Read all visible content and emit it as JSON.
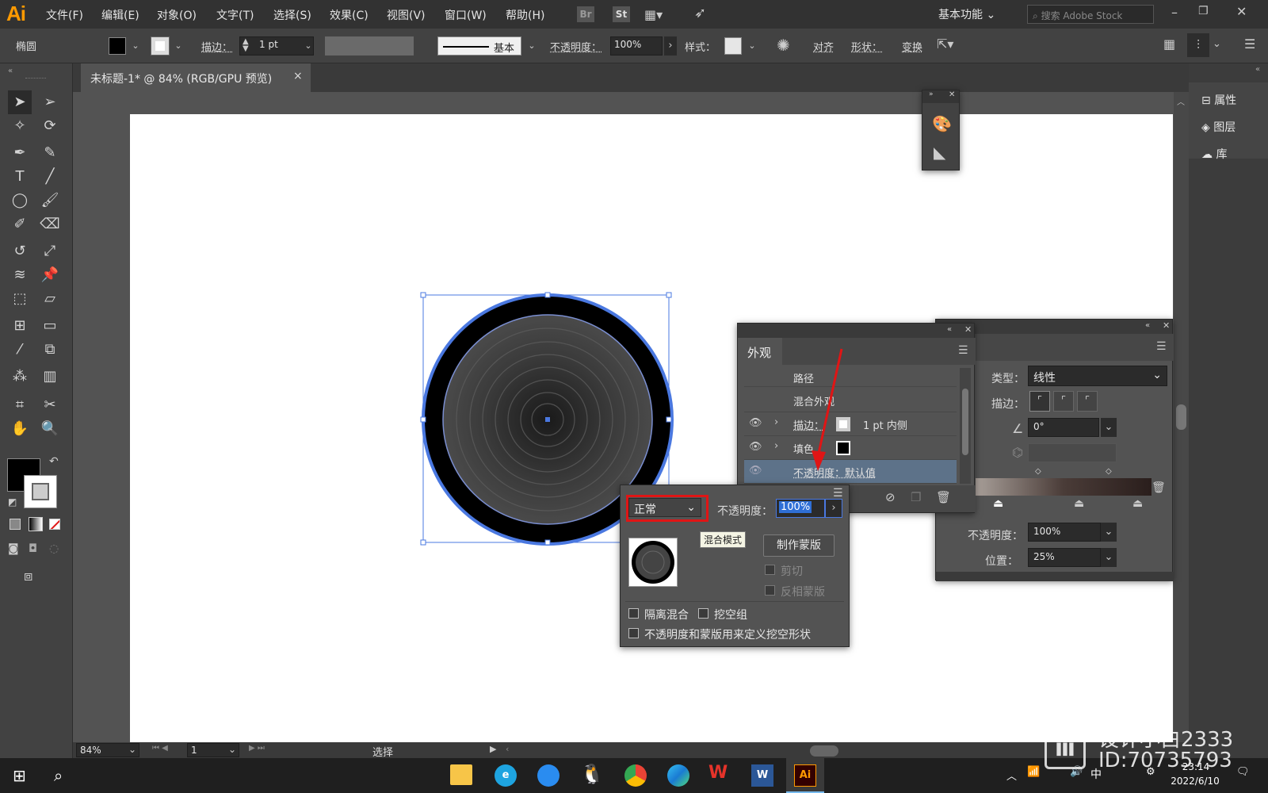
{
  "app": {
    "logo": "Ai"
  },
  "menu": [
    "文件(F)",
    "编辑(E)",
    "对象(O)",
    "文字(T)",
    "选择(S)",
    "效果(C)",
    "视图(V)",
    "窗口(W)",
    "帮助(H)"
  ],
  "menubar_right": {
    "br": "Br",
    "st": "St",
    "workspace": "基本功能",
    "search_placeholder": "搜索 Adobe Stock"
  },
  "control": {
    "object_type": "椭圆",
    "stroke_label": "描边",
    "stroke_weight": "1 pt",
    "brush_label": "基本",
    "opacity_label": "不透明度",
    "opacity_value": "100%",
    "style_label": "样式",
    "align": "对齐",
    "shape": "形状",
    "transform": "变换",
    "colon": "："
  },
  "document_tab": {
    "title": "未标题-1* @ 84% (RGB/GPU 预览)",
    "close": "×"
  },
  "right_dock": {
    "properties": "属性",
    "layers": "图层",
    "libraries": "库"
  },
  "appearance_panel": {
    "title": "外观",
    "rows": {
      "path": "路径",
      "mixed": "混合外观",
      "stroke_label": "描边",
      "stroke_detail": "1 pt  内侧",
      "fill_label": "填色",
      "opacity_row": "不透明度：默认值"
    }
  },
  "gradient_panel": {
    "type_label": "类型",
    "type_value": "线性",
    "stroke_label": "描边",
    "angle_value": "0°",
    "opacity_label": "不透明度",
    "opacity_value": "100%",
    "position_label": "位置",
    "position_value": "25%",
    "colon": "："
  },
  "transparency_popup": {
    "blend_mode": "正常",
    "blend_tooltip": "混合模式",
    "opacity_label": "不透明度：",
    "opacity_value": "100%",
    "make_mask": "制作蒙版",
    "clip": "剪切",
    "invert_mask": "反相蒙版",
    "isolate_blending": "隔离混合",
    "knockout_group": "挖空组",
    "knockout_shape": "不透明度和蒙版用来定义挖空形状"
  },
  "status": {
    "zoom": "84%",
    "artboard": "1",
    "mode": "选择"
  },
  "taskbar": {
    "time": "23:14",
    "date": "2022/6/10",
    "ime": "中",
    "ai": "Ai"
  },
  "watermark": {
    "line1": "设计小白2333",
    "line2": "ID:70735793"
  },
  "colors": {
    "accent_blue": "#4a78e0",
    "highlight_red": "#e01515",
    "ai_orange": "#ff9a00"
  }
}
